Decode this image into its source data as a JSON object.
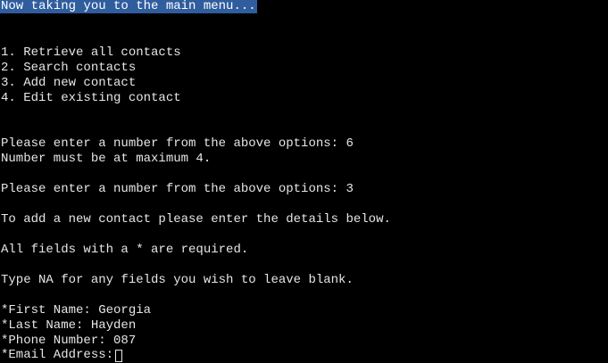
{
  "banner": "Now taking you to the main menu...",
  "menu": [
    "1. Retrieve all contacts",
    "2. Search contacts",
    "3. Add new contact",
    "4. Edit existing contact"
  ],
  "prompt1": "Please enter a number from the above options: 6",
  "error": "Number must be at maximum 4.",
  "prompt2": "Please enter a number from the above options: 3",
  "info1": "To add a new contact please enter the details below.",
  "info2": "All fields with a * are required.",
  "info3": "Type NA for any fields you wish to leave blank.",
  "fields": {
    "first_name": "*First Name: Georgia",
    "last_name": "*Last Name: Hayden",
    "phone": "*Phone Number: 087",
    "email_label": "*Email Address:"
  },
  "colors": {
    "background": "#000000",
    "text": "#e6e6e6",
    "banner_bg": "#2f5d9e"
  }
}
